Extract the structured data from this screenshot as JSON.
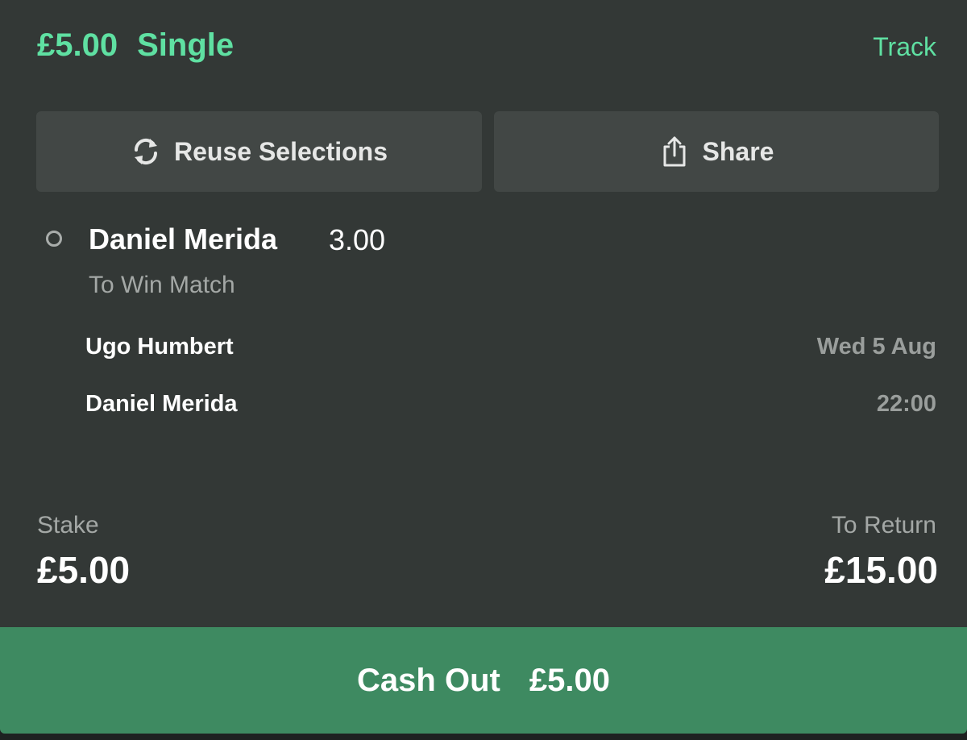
{
  "bet": {
    "stake_display": "£5.00",
    "type": "Single",
    "track_label": "Track"
  },
  "actions": {
    "reuse_label": "Reuse Selections",
    "share_label": "Share"
  },
  "selection": {
    "name": "Daniel Merida",
    "odds": "3.00",
    "market": "To Win Match"
  },
  "event": {
    "home": "Ugo Humbert",
    "away": "Daniel Merida",
    "date": "Wed 5 Aug",
    "time": "22:00"
  },
  "summary": {
    "stake_label": "Stake",
    "stake_value": "£5.00",
    "return_label": "To Return",
    "return_value": "£15.00"
  },
  "cashout": {
    "label": "Cash Out",
    "amount": "£5.00"
  },
  "colors": {
    "accent": "#5fe0a2",
    "card": "#333836",
    "button": "#424745",
    "cashout": "#3e8a61"
  },
  "icons": {
    "reuse": "refresh-icon",
    "share": "share-icon",
    "selection": "circle-icon"
  }
}
